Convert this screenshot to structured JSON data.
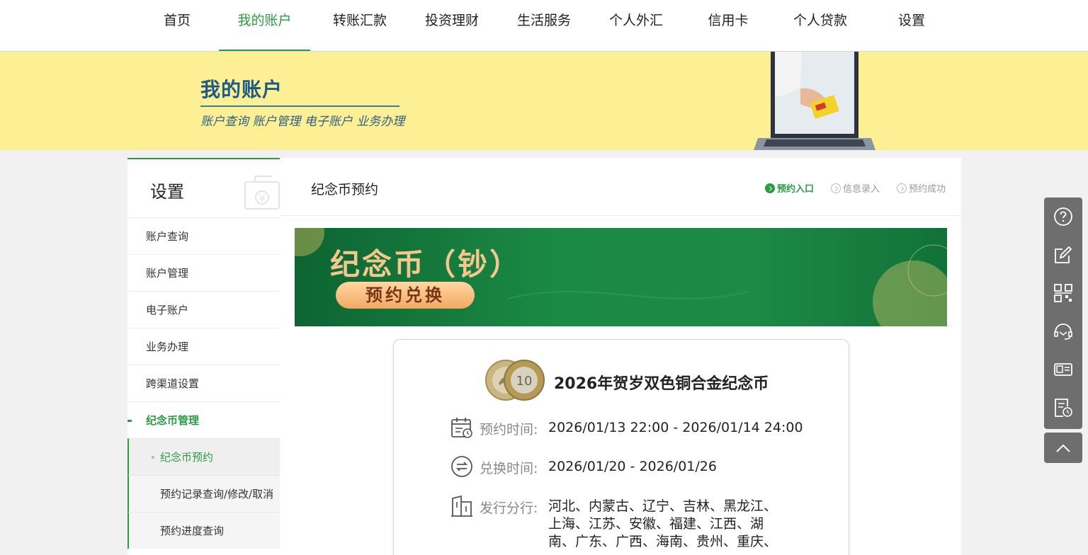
{
  "nav": {
    "items": [
      {
        "label": "首页"
      },
      {
        "label": "我的账户"
      },
      {
        "label": "转账汇款"
      },
      {
        "label": "投资理财"
      },
      {
        "label": "生活服务"
      },
      {
        "label": "个人外汇"
      },
      {
        "label": "信用卡"
      },
      {
        "label": "个人贷款"
      },
      {
        "label": "设置"
      }
    ],
    "active": "我的账户"
  },
  "banner": {
    "title": "我的账户",
    "subtitle": "账户查询 账户管理 电子账户 业务办理"
  },
  "sidebar": {
    "title": "设置",
    "items": [
      {
        "label": "账户查询"
      },
      {
        "label": "账户管理"
      },
      {
        "label": "电子账户"
      },
      {
        "label": "业务办理"
      },
      {
        "label": "跨渠道设置"
      },
      {
        "label": "纪念币管理"
      }
    ],
    "subitems": [
      {
        "label": "纪念币预约"
      },
      {
        "label": "预约记录查询/修改/取消"
      },
      {
        "label": "预约进度查询"
      }
    ]
  },
  "main": {
    "title": "纪念币预约",
    "steps": [
      {
        "label": "预约入口"
      },
      {
        "label": "信息录入"
      },
      {
        "label": "预约成功"
      }
    ],
    "promo": {
      "title": "纪念币（钞）",
      "button": "预约兑换"
    },
    "card": {
      "title": "2026年贺岁双色铜合金纪念币",
      "reserve_label": "预约时间:",
      "reserve_value": "2026/01/13 22:00 - 2026/01/14 24:00",
      "exchange_label": "兑换时间:",
      "exchange_value": "2026/01/20 - 2026/01/26",
      "branch_label": "发行分行:",
      "branch_value": "河北、内蒙古、辽宁、吉林、黑龙江、上海、江苏、安徽、福建、江西、湖南、广东、广西、海南、贵州、重庆、"
    }
  },
  "colors": {
    "accent": "#2b9b43",
    "banner_bg": "#fdf094",
    "promo_green": "#1b8a44",
    "tools_bg": "#6e6e6e"
  }
}
